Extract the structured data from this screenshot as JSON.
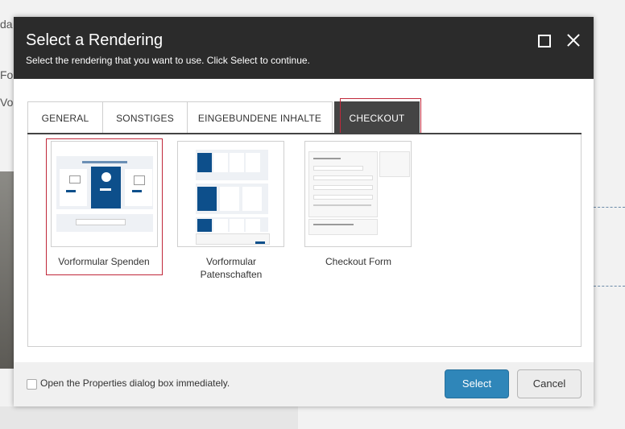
{
  "background": {
    "line1": "da",
    "line2": "For",
    "line3": "Vo"
  },
  "dialog": {
    "title": "Select a Rendering",
    "subtitle": "Select the rendering that you want to use. Click Select to continue.",
    "tabs": [
      {
        "label": "GENERAL",
        "active": false
      },
      {
        "label": "SONSTIGES",
        "active": false
      },
      {
        "label": "EINGEBUNDENE INHALTE",
        "active": false
      },
      {
        "label": "CHECKOUT",
        "active": true
      }
    ],
    "items": [
      {
        "label": "Vorformular Spenden",
        "selected": true
      },
      {
        "label": "Vorformular Patenschaften",
        "selected": false
      },
      {
        "label": "Checkout Form",
        "selected": false
      }
    ],
    "footer": {
      "checkbox_label": "Open the Properties dialog box immediately.",
      "checkbox_checked": false,
      "select_label": "Select",
      "cancel_label": "Cancel"
    }
  },
  "colors": {
    "header_bg": "#2b2b2b",
    "accent_blue": "#2f86b9",
    "selection_red": "#c0283a",
    "thumb_blue": "#0d4f8b"
  },
  "icons": [
    "maximize-icon",
    "close-icon"
  ]
}
